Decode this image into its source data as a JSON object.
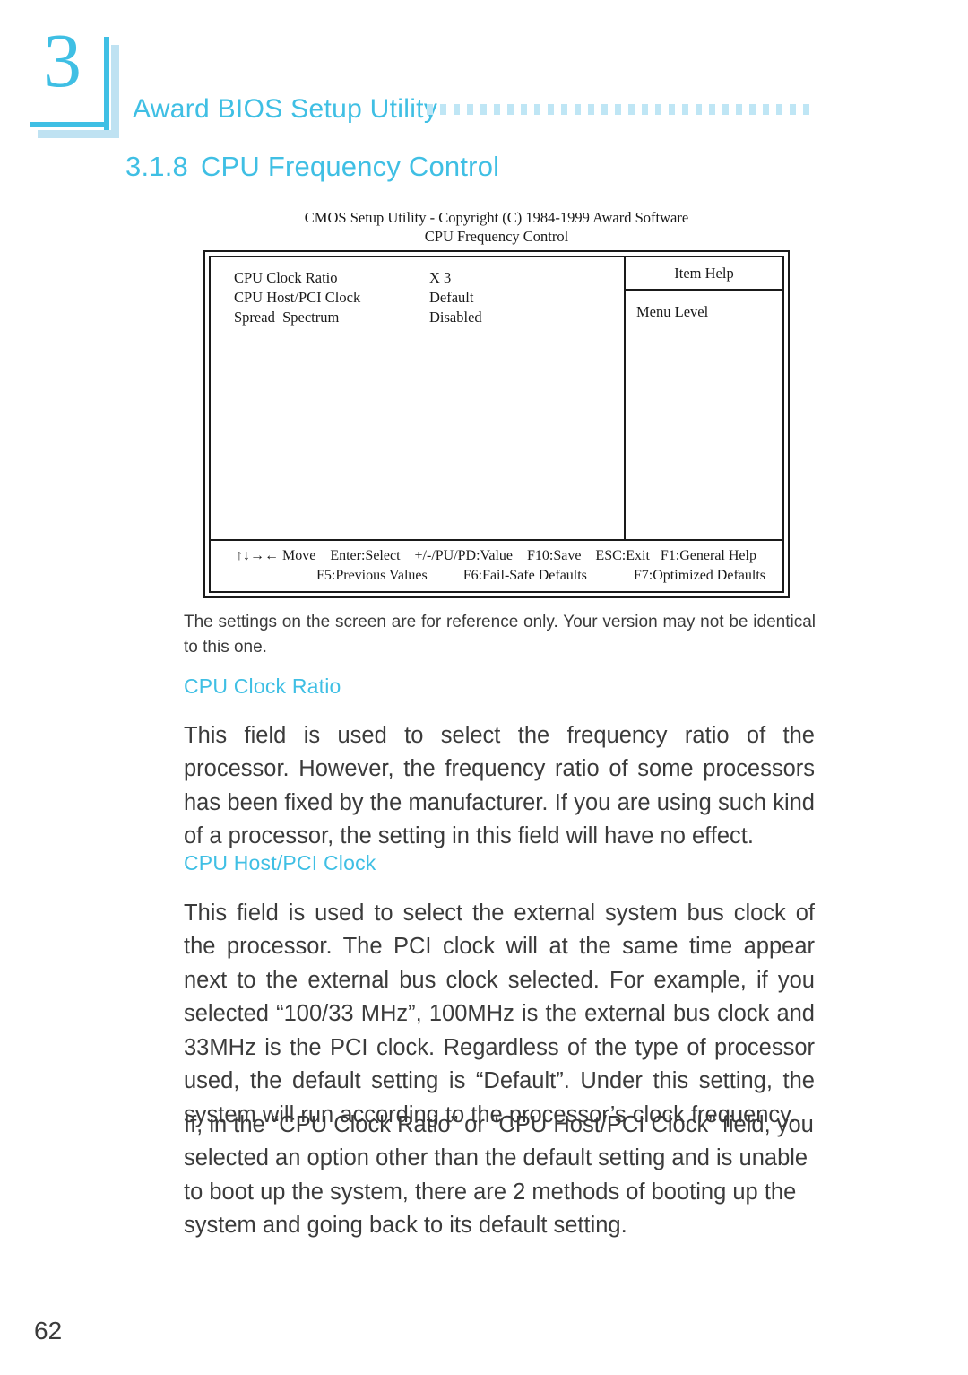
{
  "chapter": {
    "number": "3",
    "running_head": "Award BIOS Setup Utility",
    "dot_count": 29,
    "accent_color": "#3fbfe4",
    "accent_light_color": "#bfe6f5"
  },
  "section": {
    "number": "3.1.8",
    "title": "CPU Frequency Control"
  },
  "bios": {
    "title_line1": "CMOS Setup Utility - Copyright (C) 1984-1999 Award Software",
    "title_line2": "CPU Frequency Control",
    "settings": [
      {
        "label": "CPU Clock Ratio",
        "value": "X 3"
      },
      {
        "label": "CPU Host/PCI Clock",
        "value": "Default"
      },
      {
        "label": "Spread  Spectrum",
        "value": "Disabled"
      }
    ],
    "help_panel": {
      "title": "Item Help",
      "menu_level": "Menu Level"
    },
    "footer_line1": "↑↓→← Move    Enter:Select    +/-/PU/PD:Value    F10:Save    ESC:Exit   F1:General Help",
    "footer_line2": "F5:Previous Values          F6:Fail-Safe Defaults             F7:Optimized Defaults"
  },
  "caption": "The settings on the screen are for reference only. Your version may not be identical to this one.",
  "content": {
    "cpu_clock_ratio": {
      "heading": "CPU Clock Ratio",
      "paragraph": "This field is used to select the frequency ratio of the processor. However, the frequency ratio of some processors has been fixed by the manufacturer. If you are using such kind of a processor, the setting in this field will have no effect."
    },
    "cpu_host_pci_clock": {
      "heading": "CPU Host/PCI Clock",
      "paragraph": "This field is used to select the external system bus clock of the processor. The PCI clock will at the same time appear next to the external bus clock selected. For example, if you selected “100/33 MHz”, 100MHz is the external bus clock and 33MHz is the PCI clock. Regardless of the type of processor used, the default setting is “Default”. Under this setting, the system will run according to the processor’s clock frequency.",
      "paragraph2": "If, in the “CPU Clock Ratio” or “CPU Host/PCI Clock” field, you selected an option other than the default setting and is unable to boot up the system, there are 2 methods of booting up the system and going back to its default setting."
    }
  },
  "page_number": "62"
}
